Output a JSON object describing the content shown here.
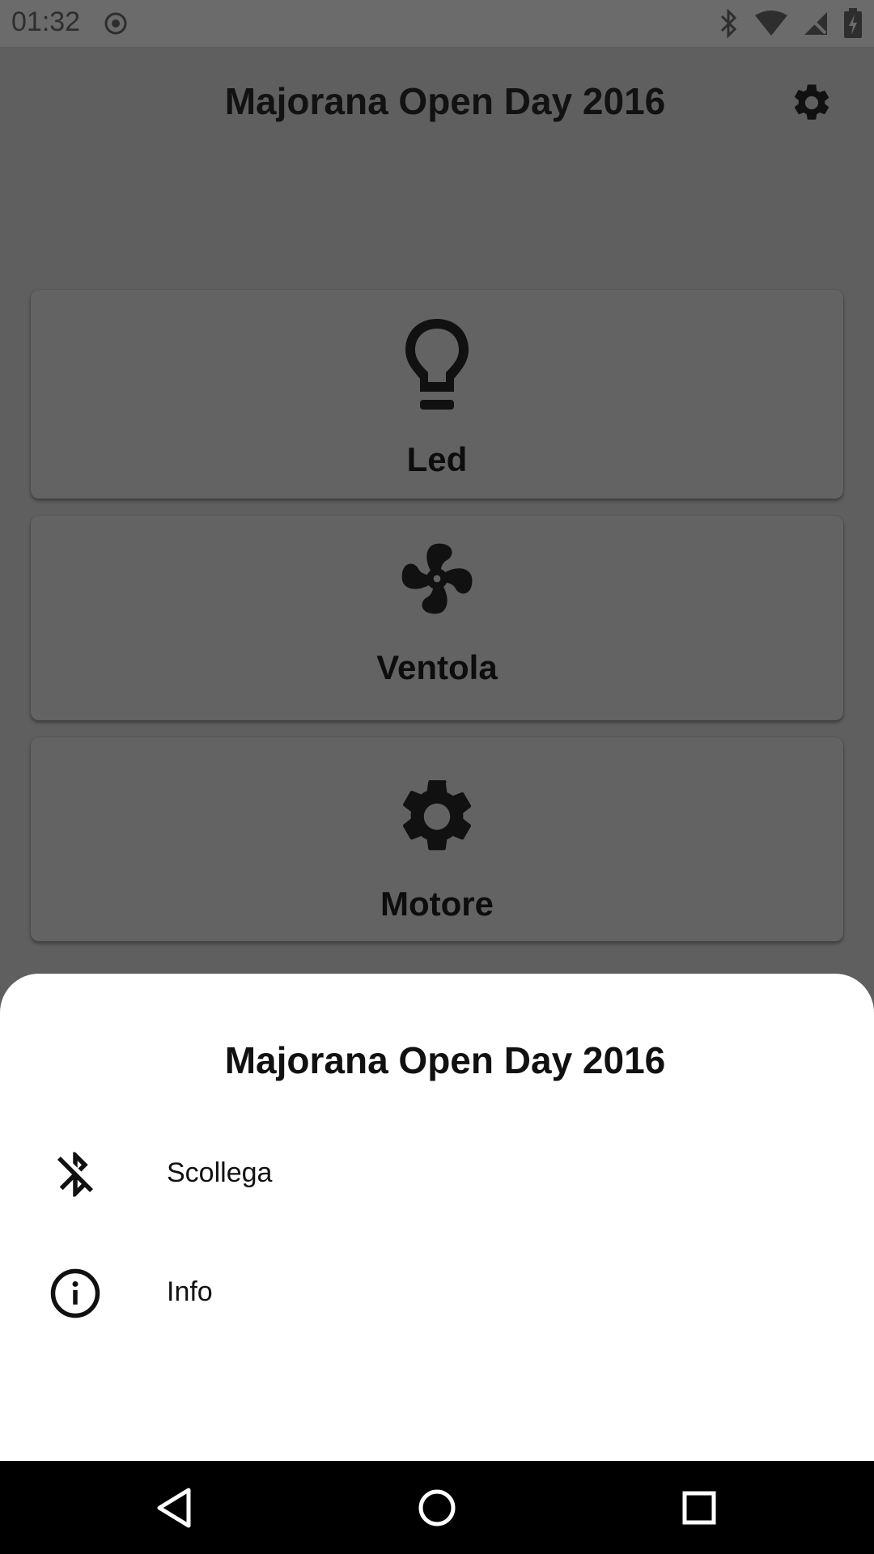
{
  "status_bar": {
    "time": "01:32",
    "icons": [
      "location-icon",
      "bluetooth-icon",
      "wifi-icon",
      "no-sim-icon",
      "battery-charging-icon"
    ]
  },
  "header": {
    "title": "Majorana Open Day 2016",
    "settings_icon": "gear-icon"
  },
  "cards": [
    {
      "label": "Led",
      "icon": "lightbulb-icon"
    },
    {
      "label": "Ventola",
      "icon": "fan-icon"
    },
    {
      "label": "Motore",
      "icon": "gear-icon"
    }
  ],
  "bottom_sheet": {
    "title": "Majorana Open Day 2016",
    "items": [
      {
        "label": "Scollega",
        "icon": "bluetooth-disabled-icon"
      },
      {
        "label": "Info",
        "icon": "info-icon"
      }
    ]
  },
  "nav_bar": {
    "icons": [
      "back-icon",
      "home-icon",
      "recents-icon"
    ]
  },
  "colors": {
    "scrim_background": "#5f5f5f",
    "sheet_background": "#ffffff",
    "nav_background": "#000000"
  }
}
